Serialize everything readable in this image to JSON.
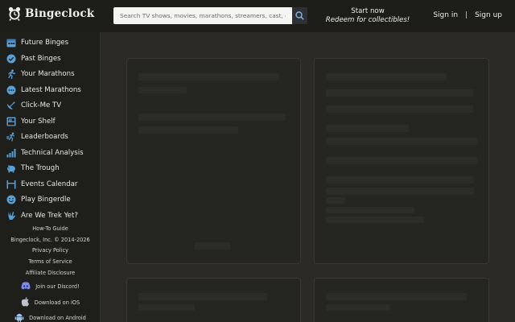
{
  "brand": {
    "name": "Bingeclock",
    "logo_icon": "clock-icon"
  },
  "search": {
    "placeholder": "Search TV shows, movies, marathons, streamers, cast, crew, and more",
    "button_icon": "search-icon"
  },
  "promo": {
    "line1": "Start now",
    "line2": "Redeem for collectibles!"
  },
  "auth": {
    "signin": "Sign in",
    "separator": "|",
    "signup": "Sign up"
  },
  "sidebar": {
    "items": [
      {
        "label": "Future Binges",
        "icon": "calendar-icon",
        "color": "#5a9fd6"
      },
      {
        "label": "Past Binges",
        "icon": "check-circle-icon",
        "color": "#5a9fd6"
      },
      {
        "label": "Your Marathons",
        "icon": "runner-icon",
        "color": "#5a9fd6"
      },
      {
        "label": "Latest Marathons",
        "icon": "ellipsis-circle-icon",
        "color": "#5a9fd6"
      },
      {
        "label": "Click-Me TV",
        "icon": "satellite-dish-icon",
        "color": "#5a9fd6"
      },
      {
        "label": "Your Shelf",
        "icon": "shelf-icon",
        "color": "#5a9fd6"
      },
      {
        "label": "Leaderboards",
        "icon": "trophy-runner-icon",
        "color": "#5a9fd6"
      },
      {
        "label": "Technical Analysis",
        "icon": "bar-chart-icon",
        "color": "#5a9fd6"
      },
      {
        "label": "The Trough",
        "icon": "pig-icon",
        "color": "#5a9fd6"
      },
      {
        "label": "Events Calendar",
        "icon": "goalpost-icon",
        "color": "#5a9fd6"
      },
      {
        "label": "Play Bingerdle",
        "icon": "smiley-icon",
        "color": "#5a9fd6"
      },
      {
        "label": "Are We Trek Yet?",
        "icon": "vulcan-hand-icon",
        "color": "#5a9fd6"
      }
    ],
    "footer": {
      "howto": "How-To Guide",
      "copyright": "Bingeclock, Inc. © 2014-2026",
      "privacy": "Privacy Policy",
      "terms": "Terms of Service",
      "affiliate": "Affiliate Disclosure",
      "discord": "Join our Discord!",
      "ios": "Download on iOS",
      "android": "Download on Android"
    }
  },
  "colors": {
    "accent": "#5a9fd6",
    "background": "#2b2a25",
    "sidebar": "#1e1e1b",
    "topbar": "#1d1d1a"
  }
}
